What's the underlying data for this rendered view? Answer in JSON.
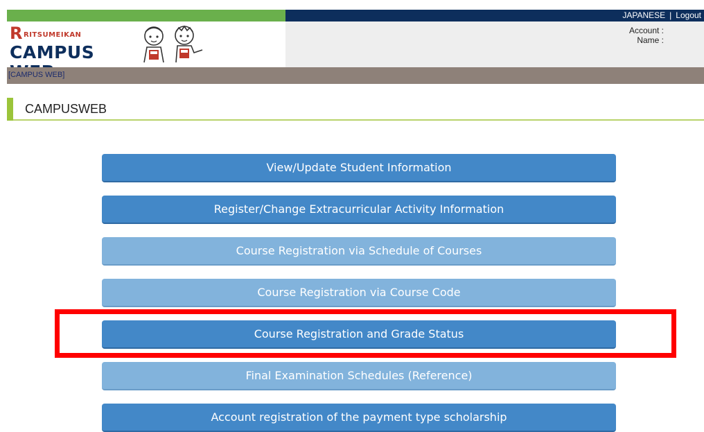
{
  "top_links": {
    "language": "JAPANESE",
    "separator": "|",
    "logout": "Logout"
  },
  "account": {
    "account_label": "Account :",
    "name_label": "Name :"
  },
  "logo": {
    "r": "R",
    "small": "RITSUMEIKAN",
    "big": "CAMPUS WEB"
  },
  "breadcrumb": "[CAMPUS WEB]",
  "page_title": "CAMPUSWEB",
  "menu": [
    {
      "label": "View/Update Student Information"
    },
    {
      "label": "Register/Change Extracurricular Activity Information"
    },
    {
      "label": "Course Registration via Schedule of Courses"
    },
    {
      "label": "Course Registration via Course Code"
    },
    {
      "label": "Course Registration and Grade Status"
    },
    {
      "label": "Final Examination Schedules (Reference)"
    },
    {
      "label": "Account registration of the payment type scholarship"
    }
  ],
  "colors": {
    "green": "#6ab04c",
    "navy": "#0d2e5c",
    "button_dark": "#4388c8",
    "button_light": "#82b3dc",
    "highlight": "#ff0000"
  }
}
